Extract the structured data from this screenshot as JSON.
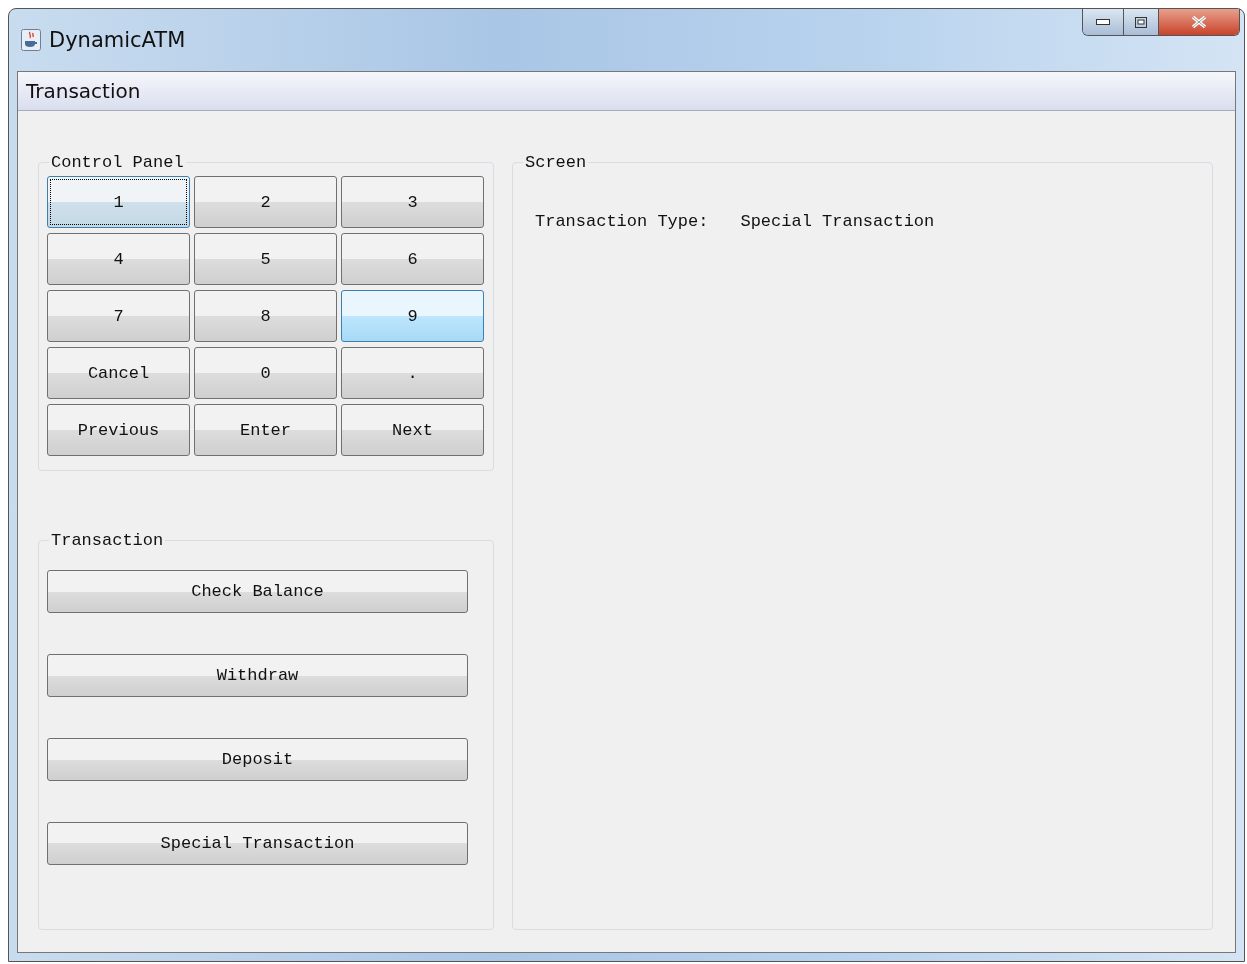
{
  "window": {
    "title": "DynamicATM"
  },
  "menu_bar": {
    "items": [
      {
        "label": "Transaction"
      }
    ]
  },
  "control_panel": {
    "title": "Control Panel",
    "keys": [
      {
        "label": "1",
        "focused": true,
        "hovered": false
      },
      {
        "label": "2",
        "focused": false,
        "hovered": false
      },
      {
        "label": "3",
        "focused": false,
        "hovered": false
      },
      {
        "label": "4",
        "focused": false,
        "hovered": false
      },
      {
        "label": "5",
        "focused": false,
        "hovered": false
      },
      {
        "label": "6",
        "focused": false,
        "hovered": false
      },
      {
        "label": "7",
        "focused": false,
        "hovered": false
      },
      {
        "label": "8",
        "focused": false,
        "hovered": false
      },
      {
        "label": "9",
        "focused": false,
        "hovered": true
      },
      {
        "label": "Cancel",
        "focused": false,
        "hovered": false
      },
      {
        "label": "0",
        "focused": false,
        "hovered": false
      },
      {
        "label": ".",
        "focused": false,
        "hovered": false
      },
      {
        "label": "Previous",
        "focused": false,
        "hovered": false
      },
      {
        "label": "Enter",
        "focused": false,
        "hovered": false
      },
      {
        "label": "Next",
        "focused": false,
        "hovered": false
      }
    ]
  },
  "transaction_panel": {
    "title": "Transaction",
    "buttons": [
      "Check Balance",
      "Withdraw",
      "Deposit",
      "Special Transaction"
    ]
  },
  "screen_panel": {
    "title": "Screen",
    "fields": [
      {
        "label": "Transaction Type:",
        "value": "Special Transaction"
      }
    ]
  }
}
